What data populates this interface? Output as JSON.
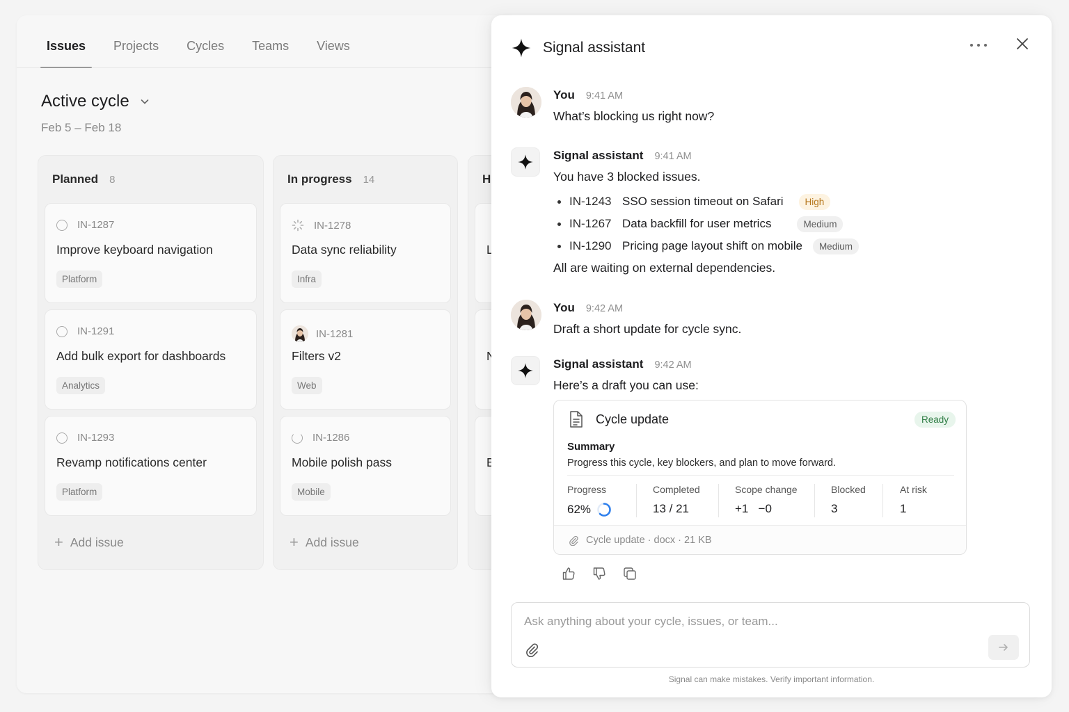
{
  "nav": {
    "tabs": [
      {
        "label": "Issues",
        "active": true
      },
      {
        "label": "Projects"
      },
      {
        "label": "Cycles"
      },
      {
        "label": "Teams"
      },
      {
        "label": "Views"
      }
    ]
  },
  "cycle": {
    "title": "Active cycle",
    "dates": "Feb 5 – Feb 18"
  },
  "columns": [
    {
      "name": "Planned",
      "count": "8",
      "cards": [
        {
          "id": "IN-1287",
          "title": "Improve keyboard navigation",
          "tag": "Platform",
          "status_icon": "todo-circle-icon"
        },
        {
          "id": "IN-1291",
          "title": "Add bulk export for dashboards",
          "tag": "Analytics",
          "status_icon": "todo-circle-icon"
        },
        {
          "id": "IN-1293",
          "title": "Revamp notifications center",
          "tag": "Platform",
          "status_icon": "todo-circle-icon"
        }
      ],
      "add_label": "Add issue"
    },
    {
      "name": "In progress",
      "count": "14",
      "cards": [
        {
          "id": "IN-1278",
          "title": "Data sync reliability",
          "tag": "Infra",
          "status_icon": "loading-spinner-icon"
        },
        {
          "id": "IN-1281",
          "title": "Filters v2",
          "tag": "Web",
          "status_icon": "assignee-avatar"
        },
        {
          "id": "IN-1286",
          "title": "Mobile polish pass",
          "tag": "Mobile",
          "status_icon": "in-progress-circle-icon"
        }
      ],
      "add_label": "Add issue"
    },
    {
      "name": "H",
      "cards": [
        {
          "title": "L"
        },
        {
          "title": "N"
        },
        {
          "title": "B"
        }
      ]
    }
  ],
  "assistant": {
    "title": "Signal assistant",
    "messages": [
      {
        "sender": "You",
        "time": "9:41 AM",
        "text": "What’s blocking us right now?"
      },
      {
        "sender": "Signal assistant",
        "time": "9:41 AM",
        "text": "You have 3 blocked issues.",
        "issues": [
          {
            "id": "IN-1243",
            "title": "SSO session timeout on Safari",
            "priority": "High"
          },
          {
            "id": "IN-1267",
            "title": "Data backfill for user metrics",
            "priority": "Medium"
          },
          {
            "id": "IN-1290",
            "title": "Pricing page layout shift on mobile",
            "priority": "Medium"
          }
        ],
        "footer": "All are waiting on external dependencies."
      },
      {
        "sender": "You",
        "time": "9:42 AM",
        "text": "Draft a short update for cycle sync."
      },
      {
        "sender": "Signal assistant",
        "time": "9:42 AM",
        "text": "Here’s a draft you can use:"
      }
    ],
    "doc": {
      "title": "Cycle update",
      "status": "Ready",
      "summary_label": "Summary",
      "summary_text": "Progress this cycle, key blockers, and plan to move forward.",
      "stats": [
        {
          "label": "Progress",
          "value": "62%",
          "progress": 0.62
        },
        {
          "label": "Completed",
          "value": "13 / 21"
        },
        {
          "label": "Scope change",
          "value": "+1   −0"
        },
        {
          "label": "Blocked",
          "value": "3"
        },
        {
          "label": "At risk",
          "value": "1"
        }
      ],
      "attachment": "Cycle update · docx · 21 KB"
    },
    "composer": {
      "placeholder": "Ask anything about your cycle, issues, or team..."
    },
    "disclaimer": "Signal can make mistakes. Verify important information."
  },
  "colors": {
    "accent_blue": "#2f80ed",
    "high": "#b5761b",
    "ready": "#2f7d45"
  }
}
